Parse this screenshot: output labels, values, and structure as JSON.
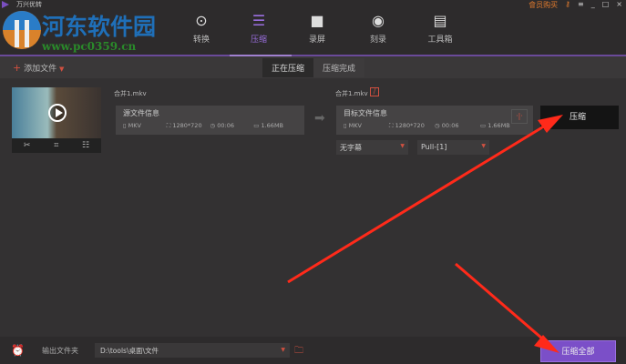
{
  "app": {
    "title": "万兴优转",
    "vip": "會员购买"
  },
  "watermark": {
    "name": "河东软件园",
    "url": "www.pc0359.cn"
  },
  "nav": [
    {
      "label": "转换",
      "icon": "play-circle-icon"
    },
    {
      "label": "压缩",
      "icon": "compress-icon",
      "active": true
    },
    {
      "label": "录屏",
      "icon": "camera-icon"
    },
    {
      "label": "刻录",
      "icon": "disc-icon"
    },
    {
      "label": "工具箱",
      "icon": "toolbox-icon"
    }
  ],
  "toolbar": {
    "add_file": "添加文件",
    "tabs": [
      "正在压缩",
      "压缩完成"
    ]
  },
  "item": {
    "source_name": "合并1.mkv",
    "source": {
      "title": "源文件信息",
      "format": "MKV",
      "resolution": "1280*720",
      "duration": "00:06",
      "size": "1.66MB"
    },
    "target_name": "合并1.mkv",
    "target": {
      "title": "目标文件信息",
      "format": "MKV",
      "resolution": "1280*720",
      "duration": "00:06",
      "size": "1.66MB"
    },
    "subtitle_select": "无字幕",
    "audio_select": "Pull-[1]",
    "compress_button": "压缩"
  },
  "bottom": {
    "output_label": "输出文件夹",
    "output_path": "D:\\tools\\桌面\\文件",
    "compress_all": "压缩全部"
  },
  "colors": {
    "accent": "#7b4fc8",
    "arrow": "#ff2a1a"
  }
}
